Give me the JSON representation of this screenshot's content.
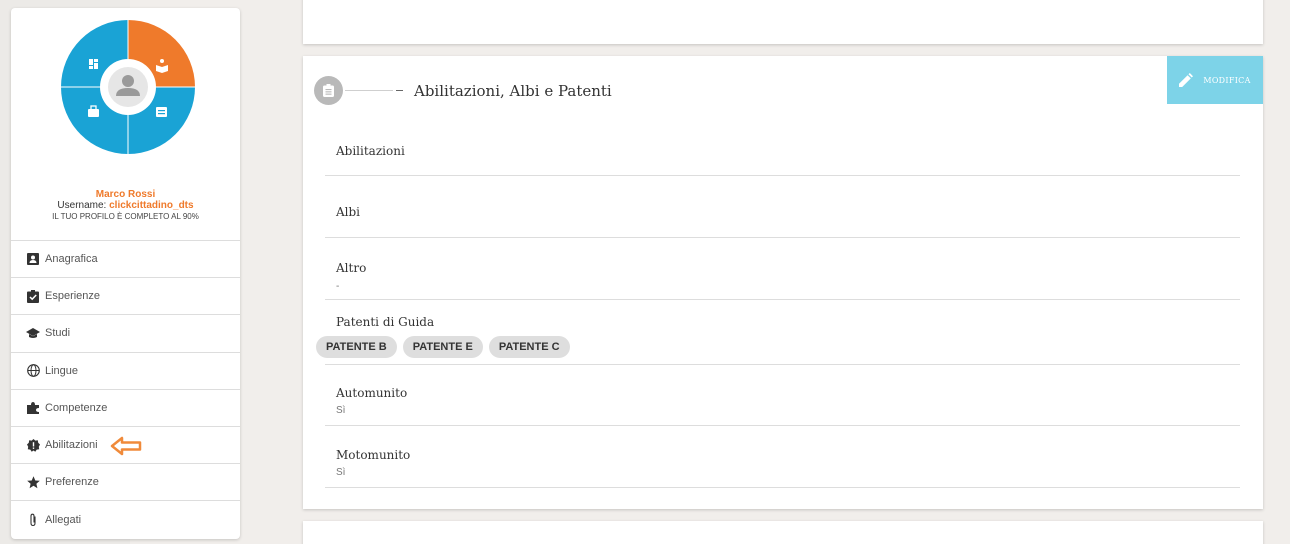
{
  "profile": {
    "name": "Marco Rossi",
    "username_label": "Username: ",
    "username": "clickcittadino_dts",
    "completion": "IL TUO PROFILO È COMPLETO AL 90%"
  },
  "menu": [
    {
      "label": "Anagrafica",
      "icon": "id-card-icon"
    },
    {
      "label": "Esperienze",
      "icon": "clipboard-check-icon"
    },
    {
      "label": "Studi",
      "icon": "graduation-cap-icon"
    },
    {
      "label": "Lingue",
      "icon": "globe-icon"
    },
    {
      "label": "Competenze",
      "icon": "puzzle-icon"
    },
    {
      "label": "Abilitazioni",
      "icon": "badge-alert-icon"
    },
    {
      "label": "Preferenze",
      "icon": "star-icon"
    },
    {
      "label": "Allegati",
      "icon": "paperclip-icon"
    }
  ],
  "section": {
    "title": "Abilitazioni, Albi e Patenti",
    "edit_label": "MODIFICA",
    "fields": {
      "abilitazioni": {
        "label": "Abilitazioni"
      },
      "albi": {
        "label": "Albi"
      },
      "altro": {
        "label": "Altro",
        "value": "-"
      },
      "patenti": {
        "label": "Patenti di Guida",
        "chips": [
          "PATENTE B",
          "PATENTE E",
          "PATENTE C"
        ]
      },
      "automunito": {
        "label": "Automunito",
        "value": "Sì"
      },
      "motomunito": {
        "label": "Motomunito",
        "value": "Sì"
      }
    }
  },
  "colors": {
    "accent": "#ef7a2b",
    "primary": "#1aa3d5",
    "edit_button": "#7dd3e8"
  }
}
